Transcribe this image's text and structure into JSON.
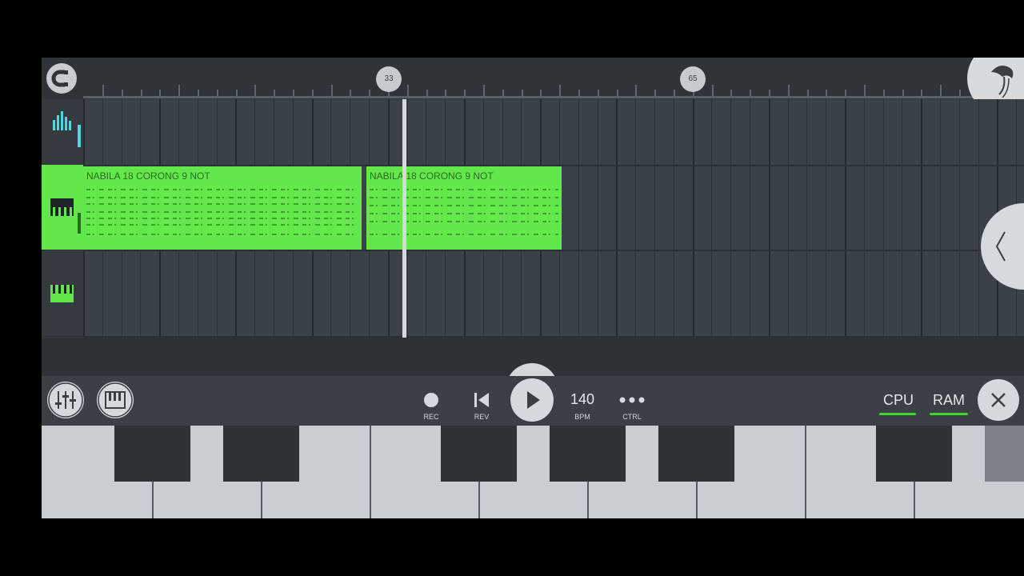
{
  "timeline": {
    "markers": [
      {
        "label": "33"
      },
      {
        "label": "65"
      }
    ]
  },
  "tracks": [
    {
      "name": "channel-rack"
    },
    {
      "name": "piano-roll-track",
      "selected": true
    },
    {
      "name": "piano-roll-track-2"
    }
  ],
  "clips": [
    {
      "title": "NABILA 18 CORONG 9 NOT"
    },
    {
      "title": "NABILA 18 CORONG 9 NOT"
    }
  ],
  "toolbar": {
    "rec_label": "REC",
    "rev_label": "REV",
    "bpm_value": "140",
    "bpm_label": "BPM",
    "ctrl_label": "CTRL",
    "cpu_label": "CPU",
    "ram_label": "RAM"
  },
  "colors": {
    "clip_green": "#63e84c",
    "meter_green": "#3cd92e",
    "background": "#343a3f"
  },
  "icons": [
    "magnet-icon",
    "fl-fruit-logo-icon",
    "mixer-icon",
    "piano-icon",
    "record-icon",
    "rewind-icon",
    "play-icon",
    "more-icon",
    "close-icon",
    "chevron-left-icon"
  ]
}
